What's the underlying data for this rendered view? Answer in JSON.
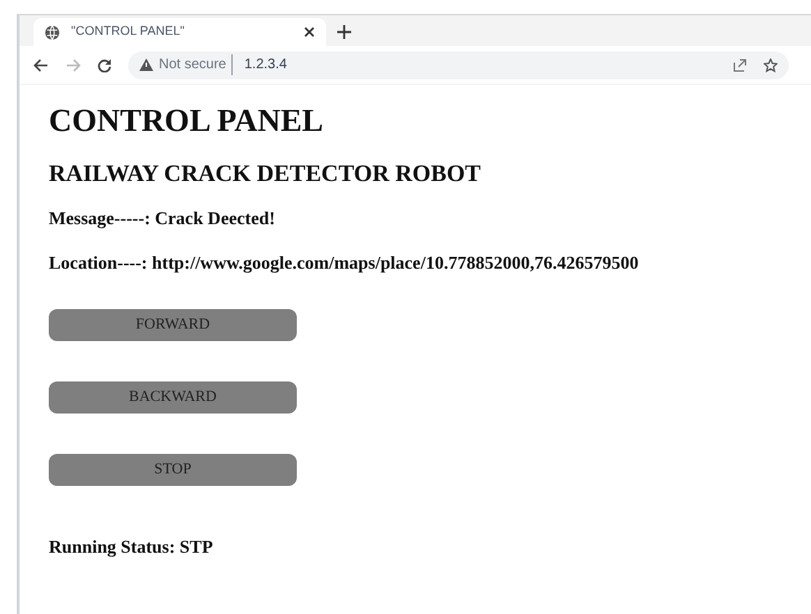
{
  "browser": {
    "tab": {
      "title": "\"CONTROL PANEL\"",
      "selected": true
    },
    "address_bar": {
      "security": "Not secure",
      "url": "1.2.3.4"
    }
  },
  "page": {
    "title": "CONTROL PANEL",
    "subtitle": "RAILWAY CRACK DETECTOR ROBOT",
    "lines": [
      {
        "label": "Message-----:",
        "value": "Crack Deected!"
      },
      {
        "label": "Location----:",
        "value": "http://www.google.com/maps/place/10.778852000,76.426579500"
      }
    ],
    "buttons": [
      "FORWARD",
      "BACKWARD",
      "STOP"
    ],
    "status": {
      "label": "Running Status:",
      "value": "STP"
    }
  }
}
